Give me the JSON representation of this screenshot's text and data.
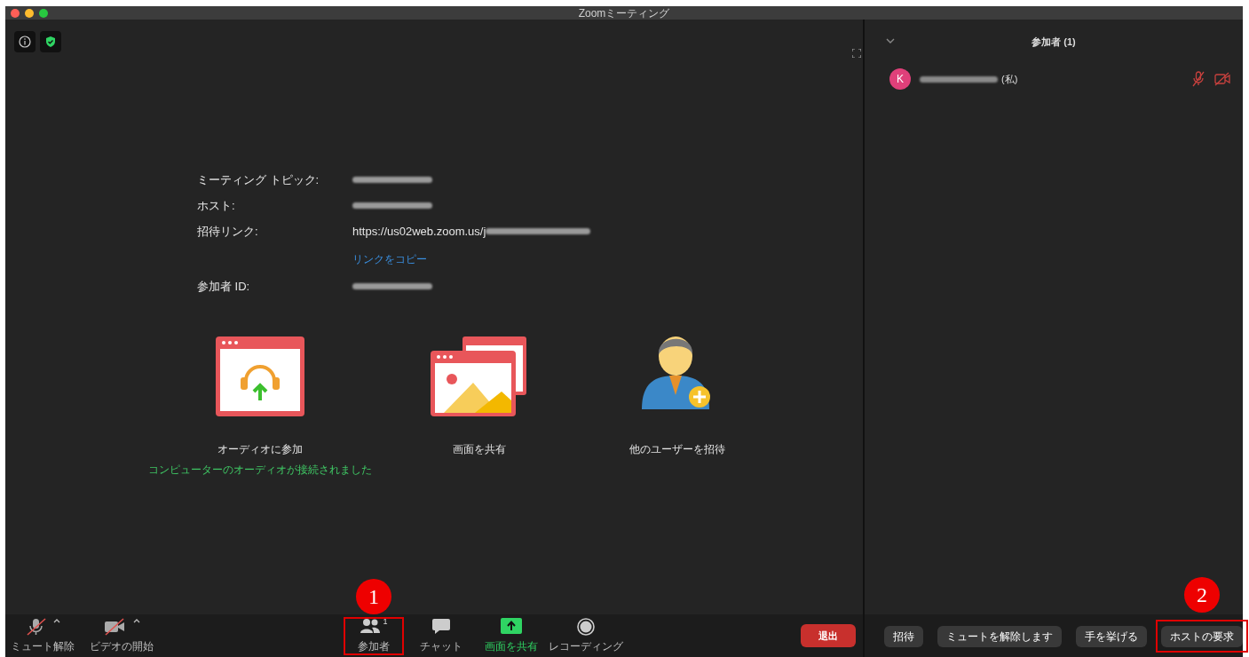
{
  "window": {
    "title": "Zoomミーティング"
  },
  "meeting_info": {
    "rows": [
      {
        "label": "ミーティング トピック:",
        "kind": "blurred"
      },
      {
        "label": "ホスト:",
        "kind": "blurred"
      },
      {
        "label": "招待リンク:",
        "kind": "link",
        "value": "https://us02web.zoom.us/j",
        "link_action": "リンクをコピー"
      },
      {
        "label": "参加者 ID:",
        "kind": "blurred"
      }
    ]
  },
  "actions": [
    {
      "kind": "audio",
      "label": "オーディオに参加",
      "status": "コンピューターのオーディオが接続されました"
    },
    {
      "kind": "share",
      "label": "画面を共有"
    },
    {
      "kind": "invite",
      "label": "他のユーザーを招待"
    }
  ],
  "toolbar": [
    {
      "kind": "mic",
      "label": "ミュート解除",
      "off": true,
      "caret": true,
      "highlighted": false
    },
    {
      "kind": "video",
      "label": "ビデオの開始",
      "off": true,
      "caret": true,
      "highlighted": false
    },
    {
      "kind": "participants",
      "label": "参加者",
      "count": "1",
      "highlighted": false,
      "annotation": "1"
    },
    {
      "kind": "chat",
      "label": "チャット",
      "highlighted": false
    },
    {
      "kind": "share",
      "label": "画面を共有",
      "highlighted": true
    },
    {
      "kind": "record",
      "label": "レコーディング",
      "highlighted": false
    }
  ],
  "leave_button": "退出",
  "participants_panel": {
    "title": "参加者 (1)",
    "participants": [
      {
        "initial": "K",
        "suffix": "(私)",
        "muted": true,
        "video_off": true
      }
    ],
    "buttons": [
      {
        "label": "招待"
      },
      {
        "label": "ミュートを解除します"
      },
      {
        "label": "手を挙げる"
      },
      {
        "label": "ホストの要求",
        "annotation": "2"
      }
    ]
  }
}
